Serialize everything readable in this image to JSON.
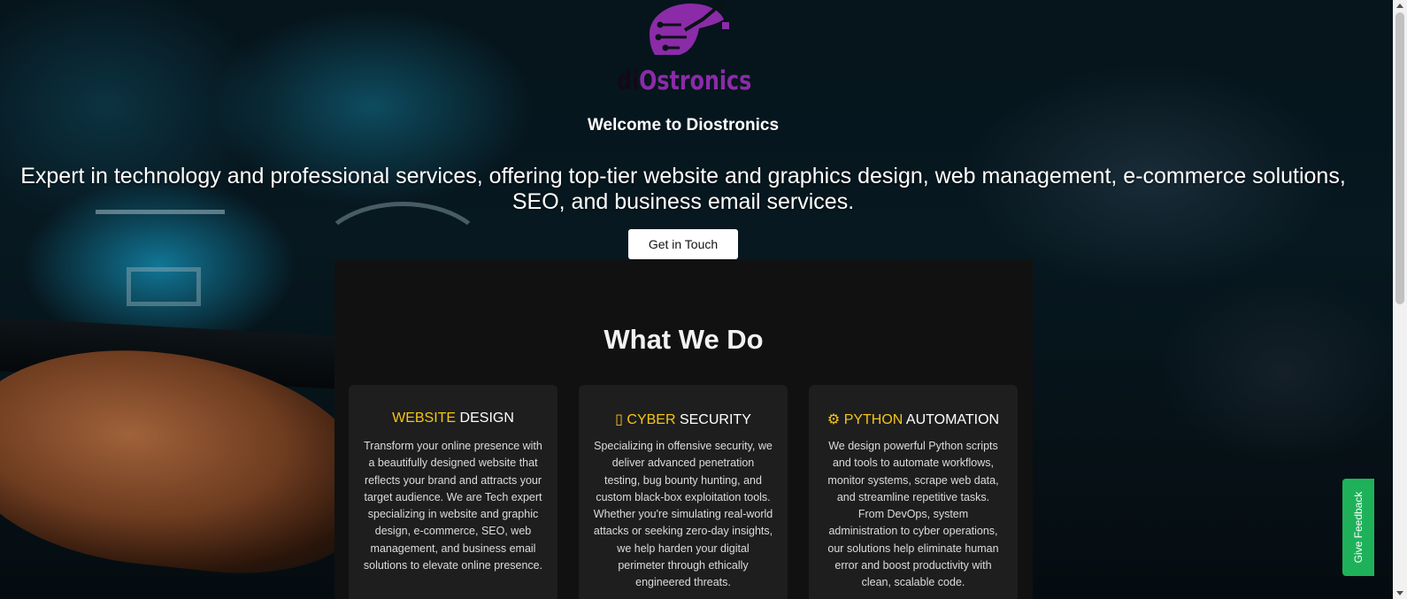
{
  "brand": {
    "logo_text_dark": "di",
    "logo_text": "Ostronics",
    "logo_color": "#8b2ba8"
  },
  "hero": {
    "welcome": "Welcome to Diostronics",
    "tagline": "Expert in technology and professional services, offering top-tier website and graphics design, web management, e-commerce solutions, SEO, and business email services.",
    "cta_label": "Get in Touch"
  },
  "services": {
    "title": "What We Do",
    "accent_color": "#f5c518",
    "cards": [
      {
        "icon": "",
        "title_accent": "WEBSITE",
        "title_rest": " DESIGN",
        "body": "Transform your online presence with a beautifully designed website that reflects your brand and attracts your target audience. We are Tech expert specializing in website and graphic design, e-commerce, SEO, web management, and business email solutions to elevate online presence."
      },
      {
        "icon": "▯",
        "title_accent": "CYBER",
        "title_rest": " SECURITY",
        "body": "Specializing in offensive security, we deliver advanced penetration testing, bug bounty hunting, and custom black-box exploitation tools. Whether you're simulating real-world attacks or seeking zero-day insights, we help harden your digital perimeter through ethically engineered threats."
      },
      {
        "icon": "⚙",
        "title_accent": "PYTHON",
        "title_rest": " AUTOMATION",
        "body": "We design powerful Python scripts and tools to automate workflows, monitor systems, scrape web data, and streamline repetitive tasks. From DevOps, system administration to cyber operations, our solutions help eliminate human error and boost productivity with clean, scalable code."
      }
    ]
  },
  "feedback": {
    "label": "Give Feedback",
    "color": "#1fb15a"
  }
}
